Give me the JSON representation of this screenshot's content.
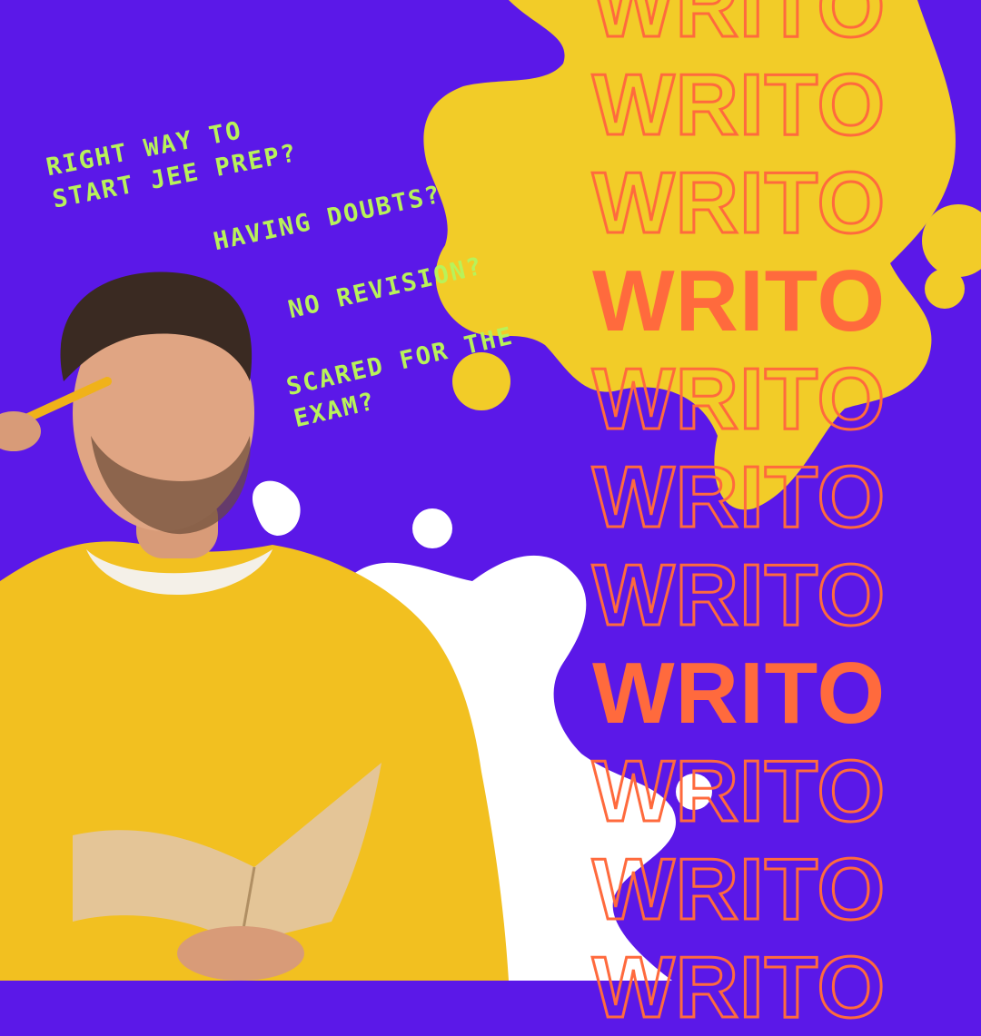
{
  "colors": {
    "background": "#5b18e8",
    "splash_yellow": "#f2cc28",
    "splash_white": "#ffffff",
    "question_text": "#b8f25a",
    "brand_orange": "#ff6a3d",
    "sweater": "#f2c020"
  },
  "questions": [
    "RIGHT WAY TO\nSTART JEE PREP?",
    "HAVING DOUBTS?",
    "NO REVISION?",
    "SCARED FOR THE\nEXAM?"
  ],
  "brand_word": "WRITO",
  "brand_rows": [
    {
      "style": "outline"
    },
    {
      "style": "outline"
    },
    {
      "style": "outline"
    },
    {
      "style": "filled"
    },
    {
      "style": "outline"
    },
    {
      "style": "outline"
    },
    {
      "style": "outline"
    },
    {
      "style": "filled"
    },
    {
      "style": "outline"
    },
    {
      "style": "outline"
    },
    {
      "style": "outline"
    }
  ]
}
